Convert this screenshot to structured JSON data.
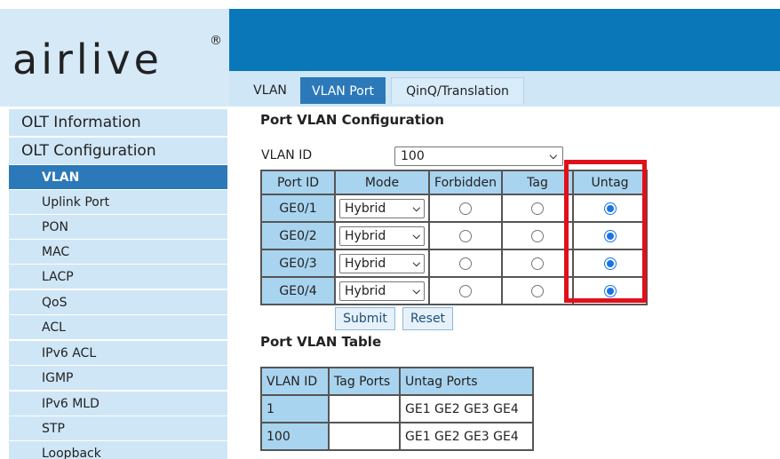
{
  "logo": {
    "text": "airlive",
    "reg": "®"
  },
  "tabs": [
    {
      "label": "VLAN"
    },
    {
      "label": "VLAN Port"
    },
    {
      "label": "QinQ/Translation"
    }
  ],
  "sidebar": {
    "top": [
      {
        "label": "OLT Information"
      },
      {
        "label": "OLT Configuration"
      }
    ],
    "sub": [
      {
        "label": "VLAN"
      },
      {
        "label": "Uplink Port"
      },
      {
        "label": "PON"
      },
      {
        "label": "MAC"
      },
      {
        "label": "LACP"
      },
      {
        "label": "QoS"
      },
      {
        "label": "ACL"
      },
      {
        "label": "IPv6 ACL"
      },
      {
        "label": "IGMP"
      },
      {
        "label": "IPv6 MLD"
      },
      {
        "label": "STP"
      },
      {
        "label": "Loopback"
      }
    ]
  },
  "config": {
    "title": "Port VLAN Configuration",
    "vlan_id_label": "VLAN ID",
    "vlan_id_value": "100",
    "headers": [
      "Port ID",
      "Mode",
      "Forbidden",
      "Tag",
      "Untag"
    ],
    "rows": [
      {
        "port": "GE0/1",
        "mode": "Hybrid",
        "selected": "Untag"
      },
      {
        "port": "GE0/2",
        "mode": "Hybrid",
        "selected": "Untag"
      },
      {
        "port": "GE0/3",
        "mode": "Hybrid",
        "selected": "Untag"
      },
      {
        "port": "GE0/4",
        "mode": "Hybrid",
        "selected": "Untag"
      }
    ],
    "submit_label": "Submit",
    "reset_label": "Reset"
  },
  "table": {
    "title": "Port VLAN Table",
    "headers": [
      "VLAN ID",
      "Tag Ports",
      "Untag Ports"
    ],
    "rows": [
      {
        "vlan_id": "1",
        "tag_ports": "",
        "untag_ports": "GE1 GE2 GE3 GE4"
      },
      {
        "vlan_id": "100",
        "tag_ports": "",
        "untag_ports": "GE1 GE2 GE3 GE4"
      }
    ]
  },
  "colors": {
    "header_blue": "#0a78b8",
    "light_blue": "#cfe6f6",
    "active_blue": "#2b79b9",
    "table_header": "#a9d4ef",
    "highlight_red": "#e0101a"
  }
}
